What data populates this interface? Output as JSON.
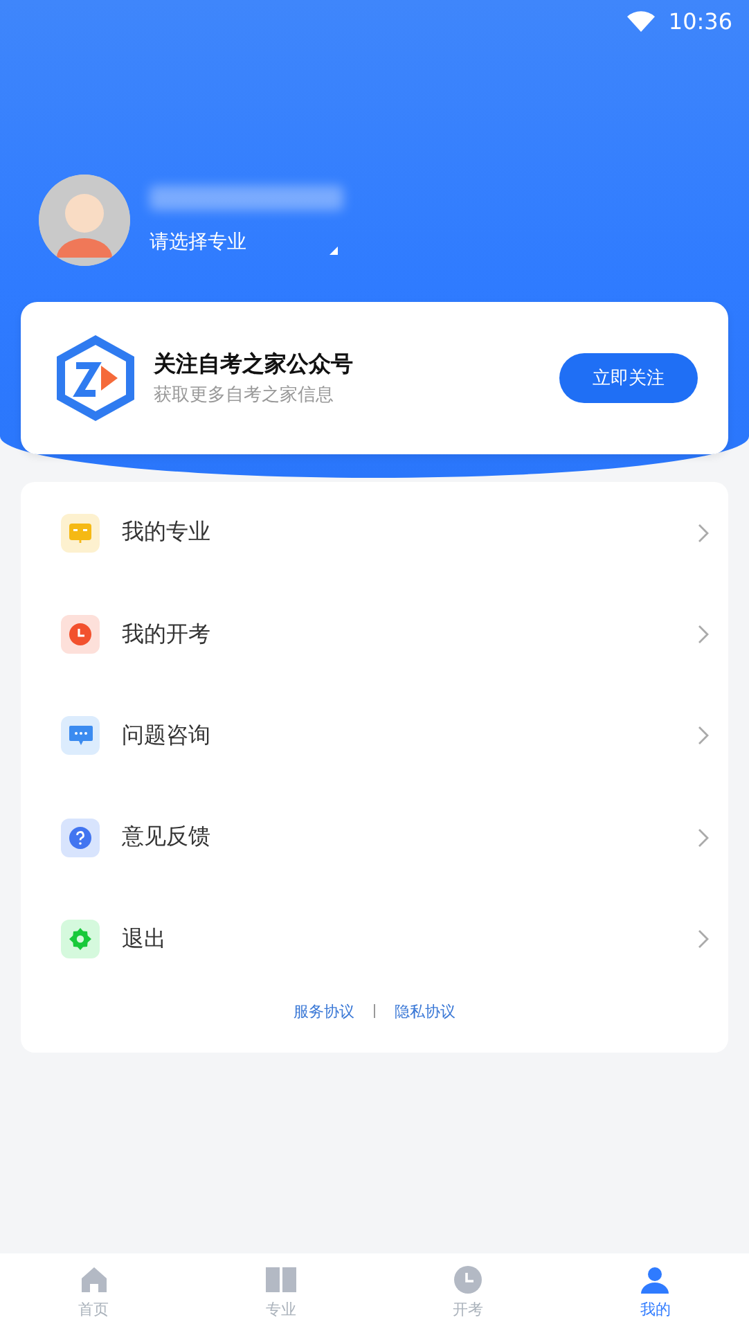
{
  "status_bar": {
    "time": "10:36"
  },
  "profile": {
    "major_prompt": "请选择专业"
  },
  "follow_card": {
    "title": "关注自考之家公众号",
    "subtitle": "获取更多自考之家信息",
    "button": "立即关注"
  },
  "menu": [
    {
      "label": "我的专业",
      "kind": "book"
    },
    {
      "label": "我的开考",
      "kind": "clock"
    },
    {
      "label": "问题咨询",
      "kind": "chat"
    },
    {
      "label": "意见反馈",
      "kind": "help"
    },
    {
      "label": "退出",
      "kind": "gear"
    }
  ],
  "footer_links": [
    "服务协议",
    "隐私协议"
  ],
  "bottom_nav": [
    {
      "label": "首页",
      "kind": "home",
      "selected": false
    },
    {
      "label": "专业",
      "kind": "book",
      "selected": false
    },
    {
      "label": "开考",
      "kind": "clock",
      "selected": false
    },
    {
      "label": "我的",
      "kind": "user",
      "selected": true
    }
  ]
}
